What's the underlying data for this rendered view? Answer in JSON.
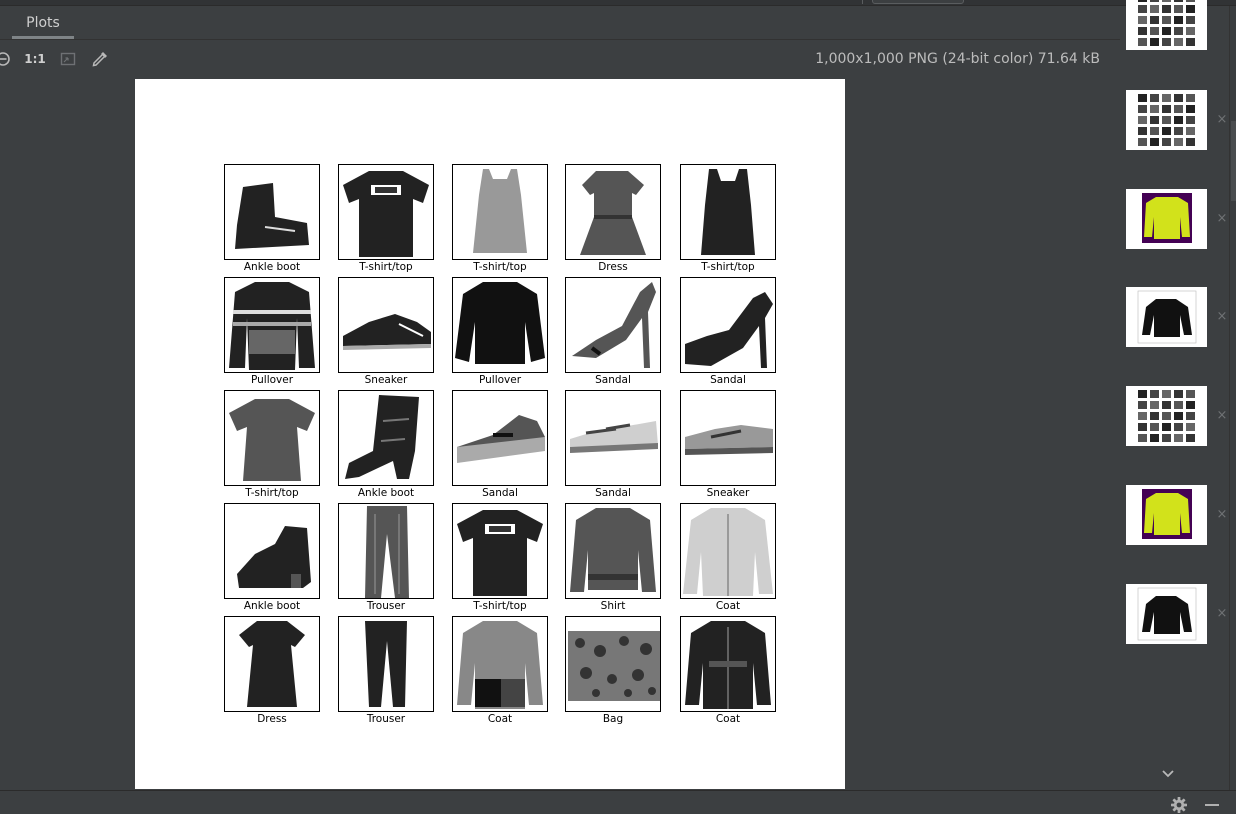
{
  "header": {
    "tab_label": "Plots",
    "settings_icon": "gear-icon",
    "minimize_icon": "minus-icon"
  },
  "toolbar": {
    "zoom_out_icon": "zoom-out-icon",
    "actual_size_label": "1:1",
    "fit_icon": "fit-window-icon",
    "color_picker_icon": "eyedropper-icon",
    "image_info": "1,000x1,000 PNG (24-bit color) 71.64 kB"
  },
  "plot": {
    "items": [
      {
        "label": "Ankle boot",
        "kind": "boot"
      },
      {
        "label": "T-shirt/top",
        "kind": "tshirt"
      },
      {
        "label": "T-shirt/top",
        "kind": "tank"
      },
      {
        "label": "Dress",
        "kind": "dress"
      },
      {
        "label": "T-shirt/top",
        "kind": "tank-dark"
      },
      {
        "label": "Pullover",
        "kind": "pullover-stripe"
      },
      {
        "label": "Sneaker",
        "kind": "sneaker"
      },
      {
        "label": "Pullover",
        "kind": "pullover"
      },
      {
        "label": "Sandal",
        "kind": "heel"
      },
      {
        "label": "Sandal",
        "kind": "heel-dark"
      },
      {
        "label": "T-shirt/top",
        "kind": "tshirt-grey"
      },
      {
        "label": "Ankle boot",
        "kind": "tall-boot"
      },
      {
        "label": "Sandal",
        "kind": "sandal"
      },
      {
        "label": "Sandal",
        "kind": "sandal-light"
      },
      {
        "label": "Sneaker",
        "kind": "sneaker-light"
      },
      {
        "label": "Ankle boot",
        "kind": "boot2"
      },
      {
        "label": "Trouser",
        "kind": "trouser-grey"
      },
      {
        "label": "T-shirt/top",
        "kind": "tshirt"
      },
      {
        "label": "Shirt",
        "kind": "pullover-grey"
      },
      {
        "label": "Coat",
        "kind": "coat-light"
      },
      {
        "label": "Dress",
        "kind": "dress-dark"
      },
      {
        "label": "Trouser",
        "kind": "trouser"
      },
      {
        "label": "Coat",
        "kind": "coat-pattern"
      },
      {
        "label": "Bag",
        "kind": "bag"
      },
      {
        "label": "Coat",
        "kind": "coat-dark"
      }
    ]
  },
  "thumbnails": [
    {
      "kind": "partial-grid",
      "close": "×"
    },
    {
      "kind": "grid",
      "close": "×"
    },
    {
      "kind": "viridis-pullover",
      "close": "×"
    },
    {
      "kind": "pullover",
      "close": "×"
    },
    {
      "kind": "grid",
      "close": "×"
    },
    {
      "kind": "viridis-pullover",
      "close": "×"
    },
    {
      "kind": "pullover",
      "close": "×"
    }
  ],
  "colors": {
    "background": "#3c3f41",
    "canvas": "#ffffff",
    "viridis_bg": "#440154",
    "viridis_fg": "#d2e21b"
  },
  "footer": {
    "settings_icon": "gear-icon",
    "minimize_icon": "minus-icon",
    "scroll_down_icon": "chevron-down-icon"
  }
}
